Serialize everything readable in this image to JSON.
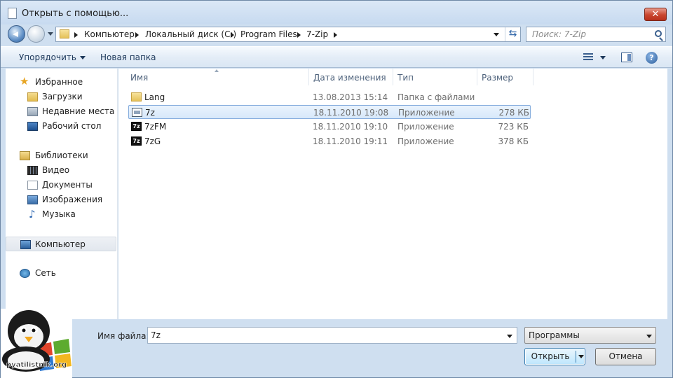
{
  "window": {
    "title": "Открыть с помощью...",
    "close_label": "✕"
  },
  "address": {
    "crumbs": [
      "Компьютер",
      "Локальный диск (C:)",
      "Program Files",
      "7-Zip"
    ],
    "search_placeholder": "Поиск: 7-Zip"
  },
  "toolbar": {
    "organize_label": "Упорядочить",
    "new_folder_label": "Новая папка",
    "help_label": "?"
  },
  "sidebar": {
    "items": [
      {
        "label": "Избранное",
        "icon": "star-icon"
      },
      {
        "label": "Загрузки",
        "icon": "downloads-folder-icon"
      },
      {
        "label": "Недавние места",
        "icon": "recent-places-icon"
      },
      {
        "label": "Рабочий стол",
        "icon": "desktop-icon"
      },
      {
        "label": "Библиотеки",
        "icon": "libraries-icon"
      },
      {
        "label": "Видео",
        "icon": "video-icon"
      },
      {
        "label": "Документы",
        "icon": "documents-icon"
      },
      {
        "label": "Изображения",
        "icon": "images-icon"
      },
      {
        "label": "Музыка",
        "icon": "music-icon"
      },
      {
        "label": "Компьютер",
        "icon": "computer-icon"
      },
      {
        "label": "Сеть",
        "icon": "network-icon"
      }
    ],
    "selected": "Компьютер"
  },
  "files": {
    "columns": [
      "Имя",
      "Дата изменения",
      "Тип",
      "Размер"
    ],
    "rows": [
      {
        "name": "Lang",
        "date": "13.08.2013 15:14",
        "type": "Папка с файлами",
        "size": "",
        "icon": "folder-icon"
      },
      {
        "name": "7z",
        "date": "18.11.2010 19:08",
        "type": "Приложение",
        "size": "278 КБ",
        "icon": "console-app-icon"
      },
      {
        "name": "7zFM",
        "date": "18.11.2010 19:10",
        "type": "Приложение",
        "size": "723 КБ",
        "icon": "7zip-app-icon",
        "icon_text": "7z"
      },
      {
        "name": "7zG",
        "date": "18.11.2010 19:11",
        "type": "Приложение",
        "size": "378 КБ",
        "icon": "7zip-app-icon",
        "icon_text": "7z"
      }
    ],
    "selected": "7z"
  },
  "footer": {
    "filename_label": "Имя файла:",
    "filename_value": "7z",
    "filetype_value": "Программы",
    "open_label": "Открыть",
    "cancel_label": "Отмена"
  },
  "watermark": {
    "text": "pyatilistnik.org"
  },
  "colors": {
    "accent": "#3c7fb1",
    "selection": "#d7e8fa",
    "window_frame": "#cfdff0"
  }
}
